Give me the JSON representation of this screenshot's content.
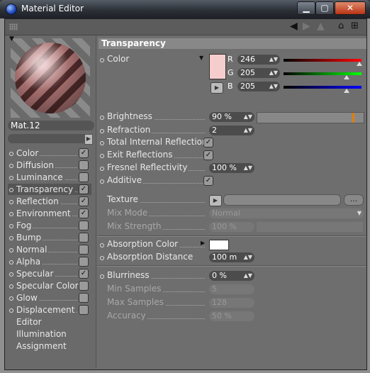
{
  "window": {
    "title": "Material Editor",
    "controls": {
      "minimize": "▁",
      "maximize": "▢",
      "close": "✕"
    },
    "colors": {
      "accent_close": "#c8461f",
      "titlebar": "#2c3037"
    }
  },
  "toolbar": {
    "icons": [
      "arrow-left-icon",
      "arrow-right-icon",
      "arrow-up-icon",
      "lock-icon",
      "new-panel-icon"
    ]
  },
  "material": {
    "name": "Mat.12"
  },
  "channels": [
    {
      "label": "Color",
      "checked": true,
      "selected": false
    },
    {
      "label": "Diffusion",
      "checked": false,
      "selected": false
    },
    {
      "label": "Luminance",
      "checked": false,
      "selected": false
    },
    {
      "label": "Transparency",
      "checked": true,
      "selected": true
    },
    {
      "label": "Reflection",
      "checked": true,
      "selected": false
    },
    {
      "label": "Environment",
      "checked": true,
      "selected": false
    },
    {
      "label": "Fog",
      "checked": false,
      "selected": false
    },
    {
      "label": "Bump",
      "checked": false,
      "selected": false
    },
    {
      "label": "Normal",
      "checked": false,
      "selected": false
    },
    {
      "label": "Alpha",
      "checked": false,
      "selected": false
    },
    {
      "label": "Specular",
      "checked": true,
      "selected": false
    },
    {
      "label": "Specular Color",
      "checked": false,
      "selected": false
    },
    {
      "label": "Glow",
      "checked": false,
      "selected": false
    },
    {
      "label": "Displacement",
      "checked": false,
      "selected": false
    }
  ],
  "extra_items": [
    "Editor",
    "Illumination",
    "Assignment"
  ],
  "panel": {
    "header": "Transparency",
    "color": {
      "label": "Color",
      "r_label": "R",
      "g_label": "G",
      "b_label": "B",
      "r": "246",
      "g": "205",
      "b": "205",
      "swatch": "#f6cdcd"
    },
    "brightness": {
      "label": "Brightness",
      "value": "90 %",
      "fraction": 0.9
    },
    "refraction": {
      "label": "Refraction",
      "value": "2"
    },
    "total_internal_reflection": {
      "label": "Total Internal Reflection",
      "checked": true
    },
    "exit_reflections": {
      "label": "Exit Reflections",
      "checked": true
    },
    "fresnel": {
      "label": "Fresnel Reflectivity",
      "value": "100 %"
    },
    "additive": {
      "label": "Additive",
      "checked": true
    },
    "texture": {
      "label": "Texture",
      "more": "..."
    },
    "mix_mode": {
      "label": "Mix Mode",
      "value": "Normal"
    },
    "mix_strength": {
      "label": "Mix Strength",
      "value": "100 %"
    },
    "absorption_color": {
      "label": "Absorption Color",
      "swatch": "#ffffff"
    },
    "absorption_distance": {
      "label": "Absorption Distance",
      "value": "100 m"
    },
    "blurriness": {
      "label": "Blurriness",
      "value": "0 %"
    },
    "min_samples": {
      "label": "Min Samples",
      "value": "5"
    },
    "max_samples": {
      "label": "Max Samples",
      "value": "128"
    },
    "accuracy": {
      "label": "Accuracy",
      "value": "50 %"
    }
  }
}
